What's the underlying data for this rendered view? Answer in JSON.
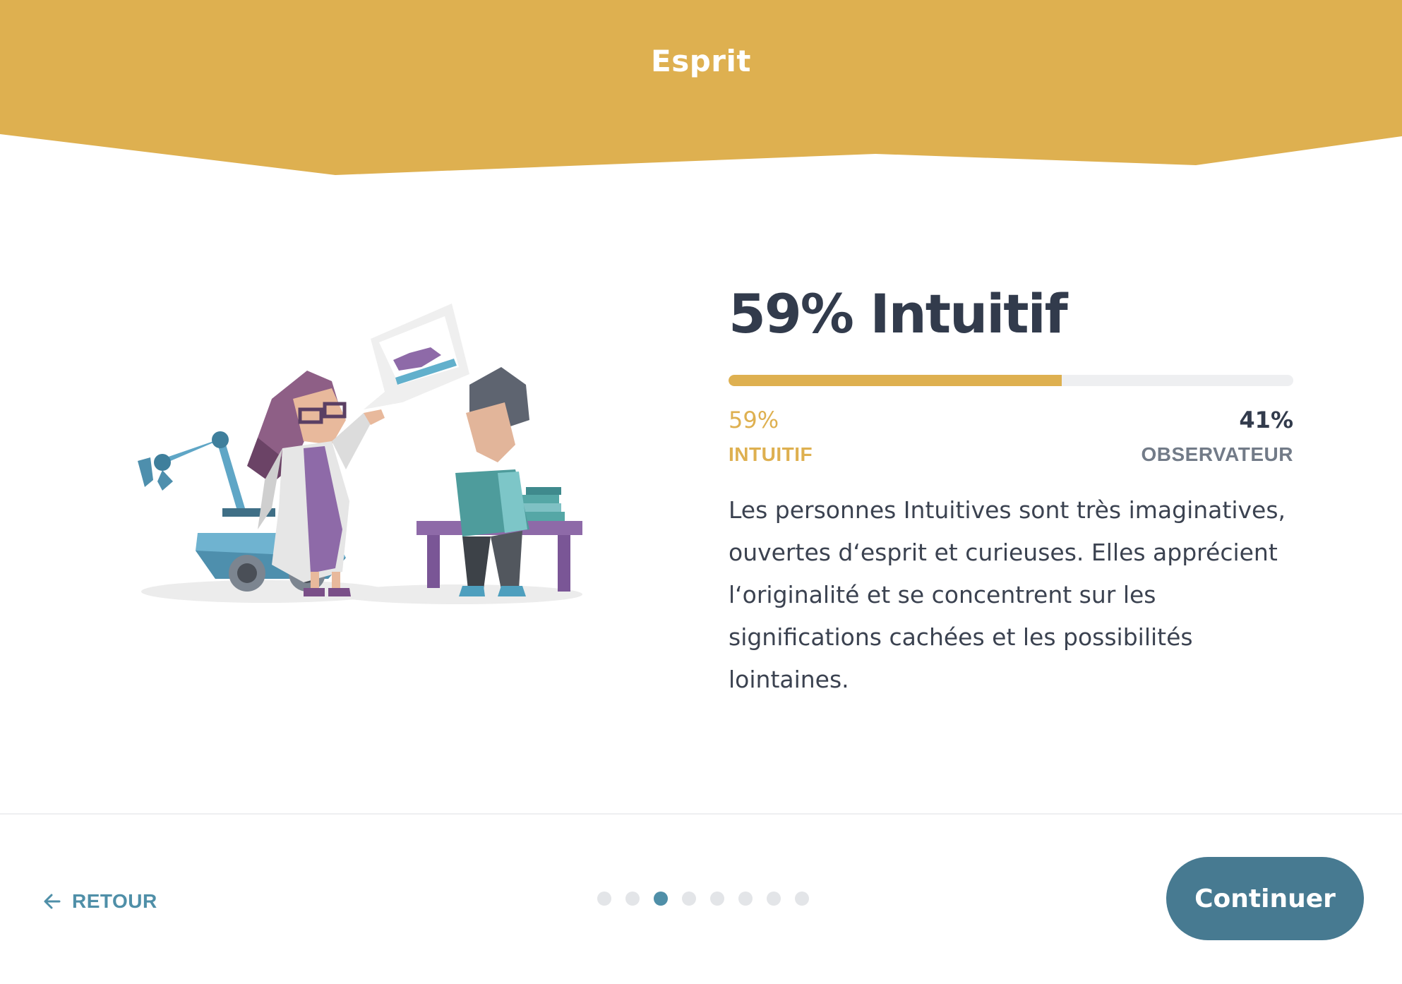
{
  "header": {
    "title": "Esprit"
  },
  "result": {
    "title": "59% Intuitif",
    "progress_fraction": 0.59,
    "left": {
      "percent": "59%",
      "label": "INTUITIF"
    },
    "right": {
      "percent": "41%",
      "label": "OBSERVATEUR"
    },
    "description": "Les personnes Intuitives sont très imaginatives, ouvertes d‘esprit et curieuses. Elles apprécient l‘originalité et se concentrent sur les significations cachées et les possibilités lointaines."
  },
  "footer": {
    "back_label": "RETOUR",
    "back_icon": "arrow-left-icon",
    "continue_label": "Continuer",
    "step_dots_total": 8,
    "step_dots_active_index": 2
  },
  "colors": {
    "accent_gold": "#deb050",
    "primary_teal": "#477a91",
    "link_blue": "#4f8fa8",
    "text_dark": "#323b4c"
  }
}
